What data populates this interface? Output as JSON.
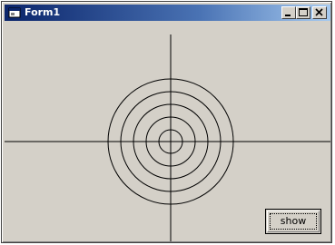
{
  "window": {
    "title": "Form1",
    "controls": {
      "minimize_icon": "minimize-icon",
      "maximize_icon": "maximize-icon",
      "close_icon": "close-icon"
    }
  },
  "canvas": {
    "circle_count": 5,
    "has_crosshair": true,
    "line_color": "#000000",
    "background": "#d4d0c8"
  },
  "buttons": {
    "show_label": "show"
  },
  "colors": {
    "titlebar_start": "#0a246a",
    "titlebar_end": "#a6caf0",
    "face": "#d4d0c8"
  }
}
